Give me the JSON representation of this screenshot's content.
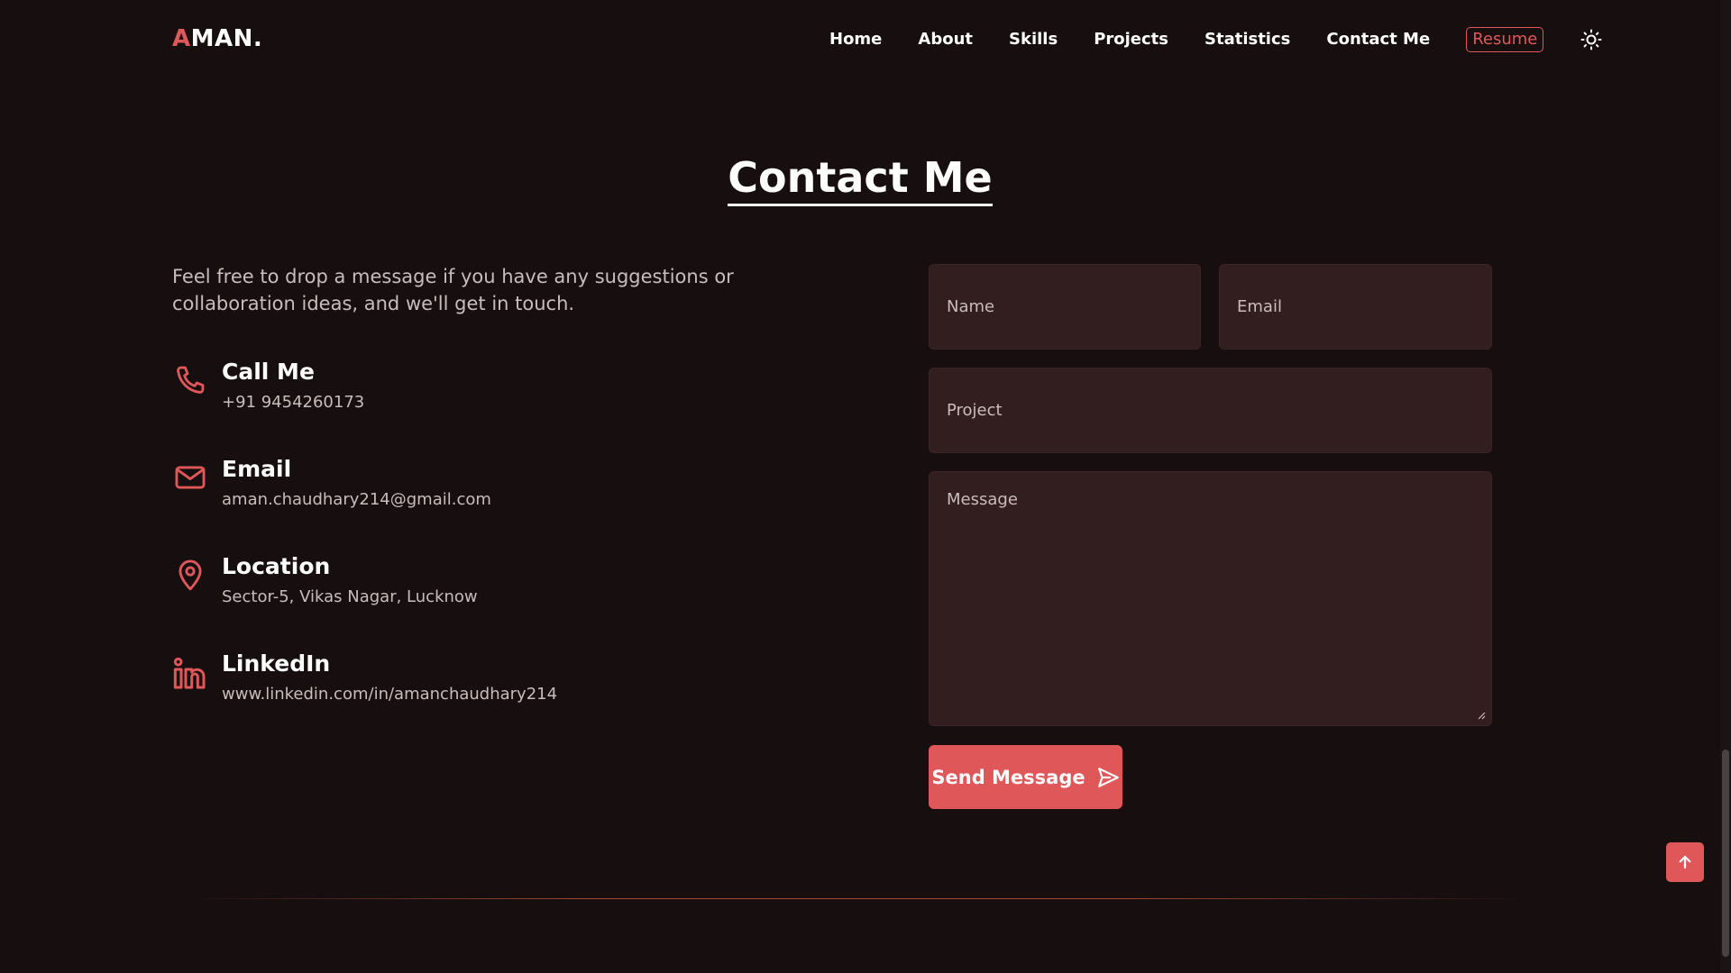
{
  "brand": {
    "logo_first": "A",
    "logo_rest": "MAN."
  },
  "nav": {
    "items": [
      {
        "label": "Home"
      },
      {
        "label": "About"
      },
      {
        "label": "Skills"
      },
      {
        "label": "Projects"
      },
      {
        "label": "Statistics"
      },
      {
        "label": "Contact Me"
      }
    ],
    "resume_label": "Resume",
    "theme_icon": "sun-icon"
  },
  "section": {
    "title": "Contact Me"
  },
  "intro": "Feel free to drop a message if you have any suggestions or collaboration ideas, and we'll get in touch.",
  "contacts": [
    {
      "label": "Call Me",
      "value": "+91 9454260173",
      "icon": "phone-icon"
    },
    {
      "label": "Email",
      "value": "aman.chaudhary214@gmail.com",
      "icon": "mail-icon"
    },
    {
      "label": "Location",
      "value": "Sector-5, Vikas Nagar, Lucknow",
      "icon": "location-pin-icon"
    },
    {
      "label": "LinkedIn",
      "value": "www.linkedin.com/in/amanchaudhary214",
      "icon": "linkedin-icon"
    }
  ],
  "form": {
    "name_placeholder": "Name",
    "email_placeholder": "Email",
    "project_placeholder": "Project",
    "message_placeholder": "Message",
    "submit_label": "Send Message",
    "submit_icon": "send-icon"
  },
  "scroll_top_icon": "arrow-up-icon",
  "colors": {
    "accent": "#e0575a",
    "background": "#170f0f",
    "field": "#321d1f",
    "muted_text": "#c9bcbc"
  }
}
